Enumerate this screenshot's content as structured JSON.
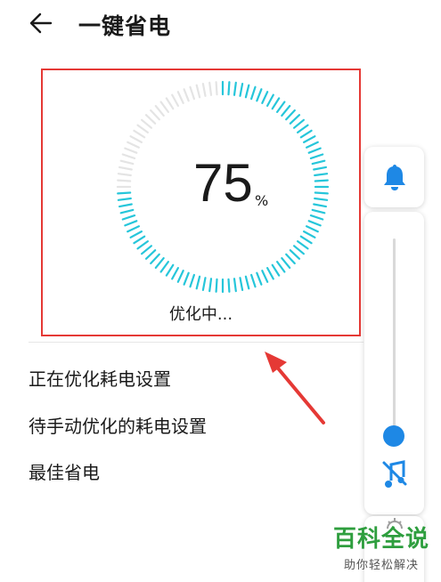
{
  "header": {
    "title": "一键省电",
    "back_icon": "arrow-left-icon"
  },
  "progress": {
    "value": 75,
    "unit": "%",
    "status": "优化中...",
    "accent": "#26c6da"
  },
  "options": [
    {
      "label": "正在优化耗电设置"
    },
    {
      "label": "待手动优化的耗电设置"
    },
    {
      "label": "最佳省电"
    }
  ],
  "volume_panel": {
    "bell_icon": "bell-icon",
    "slider_level": 0.0,
    "mute_icon": "music-off-icon",
    "accent": "#1e88e5"
  },
  "watermark": {
    "title": "百科全说",
    "subtitle": "助你轻松解决"
  },
  "annotation": {
    "highlight_color": "#e53935"
  }
}
